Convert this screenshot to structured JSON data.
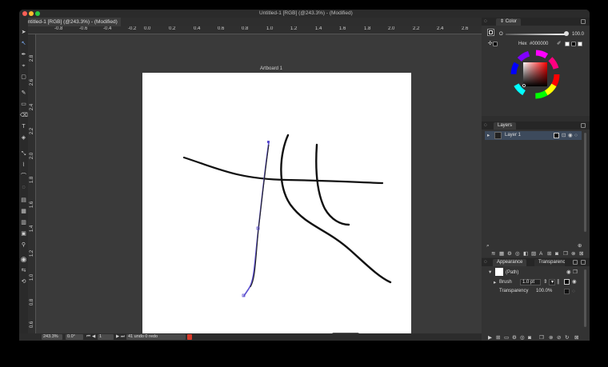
{
  "window": {
    "title": "Untitled-1 [RGB] (@243.3%) - (Modified)"
  },
  "document_tab": {
    "label": "Untitled-1 [RGB] (@243.3%) - (Modified)"
  },
  "artboard": {
    "label": "Artboard 1"
  },
  "rulers": {
    "horizontal": [
      "-0.8",
      "-0.6",
      "-0.4",
      "-0.2",
      "0.0",
      "0.2",
      "0.4",
      "0.6",
      "0.8",
      "1.0",
      "1.2",
      "1.4",
      "1.6",
      "1.8",
      "2.0",
      "2.2",
      "2.4",
      "2.6",
      "2.8"
    ],
    "vertical": [
      "2.8",
      "2.6",
      "2.4",
      "2.2",
      "2.0",
      "1.8",
      "1.6",
      "1.4",
      "1.2",
      "1.0",
      "0.8",
      "0.6",
      "0.4",
      "0.2",
      "0.0"
    ]
  },
  "statusbar": {
    "zoom": "243.3%",
    "rotation": "0.0°",
    "page": "1",
    "history": "41 undo 0 redo"
  },
  "color_panel": {
    "tab": "Color",
    "opacity_label": "O",
    "opacity_value": "100.0",
    "hex_label": "Hex",
    "hex_value": "#000000",
    "current_color": "#000000"
  },
  "layers_panel": {
    "tab": "Layers",
    "layers": [
      {
        "name": "Layer 1"
      }
    ]
  },
  "appearance_panel": {
    "tabs": [
      "Appearance",
      "Transparency"
    ],
    "object": "(Path)",
    "brush_label": "Brush",
    "brush_size": "1.0 pt",
    "transparency_label": "Transparency",
    "transparency_value": "100.0%"
  },
  "tools": [
    "selection-arrow",
    "direct-select",
    "pen",
    "anchor",
    "artboard",
    "brush",
    "rectangle",
    "eraser",
    "type",
    "shape-builder",
    "transform",
    "warp",
    "eyedropper",
    "blend",
    "symbol",
    "gradient",
    "mesh",
    "chart",
    "slice",
    "zoom",
    "fill-stroke",
    "swap",
    "screen-mode"
  ],
  "colors": {
    "accent": "#1e6fd9",
    "stroke": "#111111",
    "path_highlight": "#5b4ecf"
  }
}
